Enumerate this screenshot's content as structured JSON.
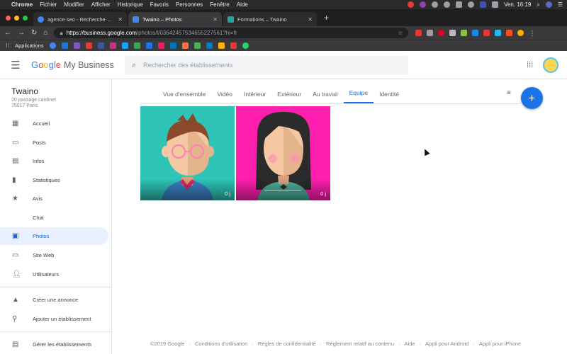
{
  "os_menu": {
    "apple": "",
    "items": [
      "Chrome",
      "Fichier",
      "Modifier",
      "Afficher",
      "Historique",
      "Favoris",
      "Personnes",
      "Fenêtre",
      "Aide"
    ],
    "clock": "Ven. 16:19"
  },
  "browser": {
    "tabs": [
      {
        "title": "agence seo - Recherche Googl",
        "favicon_color": "#4285f4",
        "active": false
      },
      {
        "title": "Twaino – Photos",
        "favicon_color": "#4285f4",
        "active": true
      },
      {
        "title": "Formations – Twaino",
        "favicon_color": "#26a69a",
        "active": false
      }
    ],
    "url_host": "https://business.google.com",
    "url_path": "/photos/l/03642457534655227561?hl=fr",
    "bookmarks_label": "Applications"
  },
  "header": {
    "logo_parts": [
      "G",
      "o",
      "o",
      "g",
      "l",
      "e"
    ],
    "product": "My Business",
    "search_placeholder": "Rechercher des établissements"
  },
  "business": {
    "name": "Twaino",
    "address_line1": "20 passage cardinet",
    "address_line2": "75017 Paris"
  },
  "sidebar": {
    "items": [
      {
        "label": "Accueil",
        "icon": "dashboard-icon"
      },
      {
        "label": "Posts",
        "icon": "posts-icon"
      },
      {
        "label": "Infos",
        "icon": "store-icon"
      },
      {
        "label": "Statistiques",
        "icon": "bar-chart-icon"
      },
      {
        "label": "Avis",
        "icon": "star-icon"
      },
      {
        "label": "Chat",
        "icon": "chat-icon"
      },
      {
        "label": "Photos",
        "icon": "photo-library-icon",
        "active": true
      },
      {
        "label": "Site Web",
        "icon": "website-icon"
      },
      {
        "label": "Utilisateurs",
        "icon": "add-user-icon"
      }
    ],
    "secondary": [
      {
        "label": "Créer une annonce",
        "icon": "ads-icon"
      },
      {
        "label": "Ajouter un établissement",
        "icon": "location-pin-icon"
      }
    ],
    "tertiary": [
      {
        "label": "Gérer les établissements",
        "icon": "manage-locations-icon"
      }
    ]
  },
  "photo_tabs": [
    {
      "label": "Vue d'ensemble"
    },
    {
      "label": "Vidéo"
    },
    {
      "label": "Intérieur"
    },
    {
      "label": "Extérieur"
    },
    {
      "label": "Au travail"
    },
    {
      "label": "Equipe",
      "active": true
    },
    {
      "label": "Identité"
    }
  ],
  "photos": [
    {
      "name": "team-photo-man",
      "age": "0 j",
      "bg": "#2ec4b6"
    },
    {
      "name": "team-photo-woman",
      "age": "0 j",
      "bg": "#ff1fae"
    }
  ],
  "fab_label": "+",
  "footer": {
    "links": [
      "©2019 Google",
      "Conditions d'utilisation",
      "Règles de confidentialité",
      "Règlement relatif au contenu",
      "Aide",
      "Appli pour Android",
      "Appli pour iPhone"
    ]
  },
  "colors": {
    "accent": "#1a73e8",
    "active_nav_bg": "#e8f0fe"
  }
}
